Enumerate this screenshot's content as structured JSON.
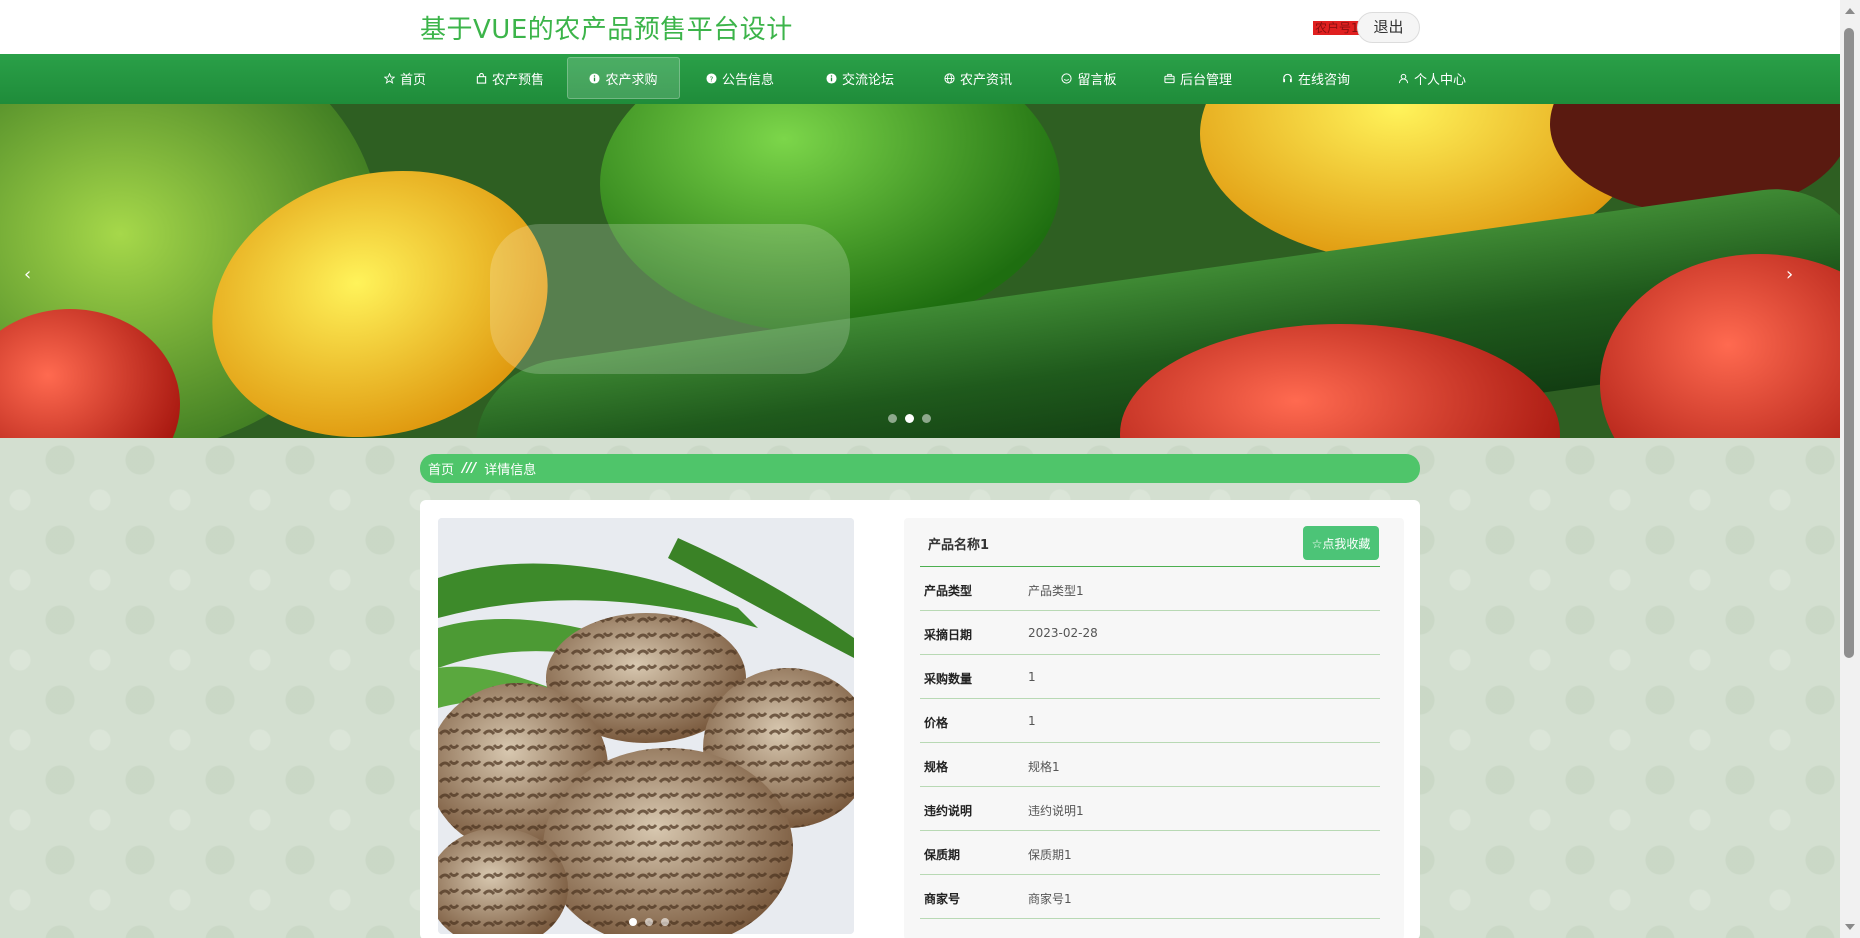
{
  "header": {
    "site_title": "基于VUE的农产品预售平台设计",
    "user_name": "农户号1",
    "logout_label": "退出"
  },
  "nav": {
    "items": [
      {
        "label": "首页",
        "icon": "star-icon"
      },
      {
        "label": "农产预售",
        "icon": "bag-icon"
      },
      {
        "label": "农产求购",
        "icon": "info-icon",
        "active": true
      },
      {
        "label": "公告信息",
        "icon": "question-icon"
      },
      {
        "label": "交流论坛",
        "icon": "info-icon"
      },
      {
        "label": "农产资讯",
        "icon": "globe-icon"
      },
      {
        "label": "留言板",
        "icon": "message-icon"
      },
      {
        "label": "后台管理",
        "icon": "briefcase-icon"
      },
      {
        "label": "在线咨询",
        "icon": "headset-icon"
      },
      {
        "label": "个人中心",
        "icon": "user-icon"
      }
    ]
  },
  "banner": {
    "prev_arrow": "‹",
    "next_arrow": "›",
    "slide_count": 3,
    "active_slide": 2
  },
  "breadcrumb": {
    "home": "首页",
    "separator": "///",
    "current": "详情信息"
  },
  "product": {
    "name": "产品名称1",
    "favorite_label": "☆点我收藏",
    "image_slide_count": 3,
    "image_active_slide": 1,
    "fields": [
      {
        "key": "产品类型",
        "value": "产品类型1"
      },
      {
        "key": "采摘日期",
        "value": "2023-02-28"
      },
      {
        "key": "采购数量",
        "value": "1"
      },
      {
        "key": "价格",
        "value": "1"
      },
      {
        "key": "规格",
        "value": "规格1"
      },
      {
        "key": "违约说明",
        "value": "违约说明1"
      },
      {
        "key": "保质期",
        "value": "保质期1"
      },
      {
        "key": "商家号",
        "value": "商家号1"
      }
    ]
  },
  "colors": {
    "brand_green": "#3cb44a",
    "nav_green": "#1f8c3a",
    "breadcrumb_green": "#4fc56a",
    "button_green": "#4cc477"
  }
}
